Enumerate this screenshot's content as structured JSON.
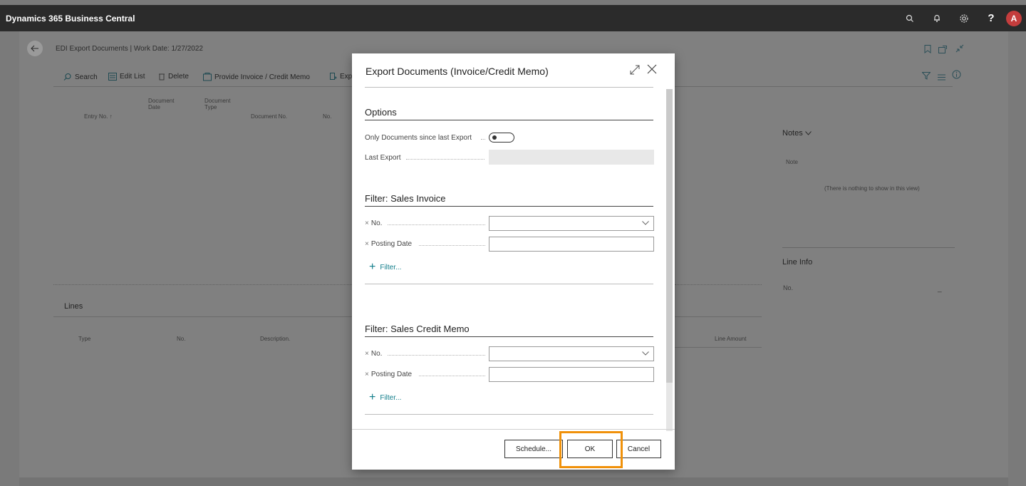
{
  "app": {
    "title": "Dynamics 365 Business Central",
    "avatar": "A",
    "help": "?"
  },
  "page": {
    "title": "EDI Export Documents | Work Date: 1/27/2022",
    "actions": [
      "Search",
      "Edit List",
      "Delete",
      "Provide Invoice / Credit Memo",
      "Exp"
    ],
    "columns": [
      {
        "label": "Entry No. ↑"
      },
      {
        "label": "Document Date"
      },
      {
        "label": "Document Type"
      },
      {
        "label": "Document No."
      },
      {
        "label": "No."
      }
    ],
    "lines": {
      "title": "Lines",
      "columns": [
        "Type",
        "No.",
        "Description.",
        "Line Amount"
      ]
    },
    "factbox": {
      "notes_title": "Notes",
      "note_label": "Note",
      "empty_message": "(There is nothing to show in this view)",
      "line_info_title": "Line Info",
      "line_no_label": "No.",
      "line_no_value": "_"
    }
  },
  "dialog": {
    "title": "Export Documents (Invoice/Credit Memo)",
    "options": {
      "title": "Options",
      "only_since_last_export_label": "Only Documents since last Export",
      "only_since_last_export_value": false,
      "last_export_label": "Last Export",
      "last_export_value": ""
    },
    "invoice_filter": {
      "title": "Filter: Sales Invoice",
      "no_label": "No.",
      "no_value": "",
      "posting_date_label": "Posting Date",
      "posting_date_value": "",
      "add_filter_label": "Filter..."
    },
    "credit_memo_filter": {
      "title": "Filter: Sales Credit Memo",
      "no_label": "No.",
      "no_value": "",
      "posting_date_label": "Posting Date",
      "posting_date_value": "",
      "add_filter_label": "Filter..."
    },
    "buttons": {
      "schedule": "Schedule...",
      "ok": "OK",
      "cancel": "Cancel"
    }
  },
  "colors": {
    "topbar": "#2b2b2b",
    "accent_link": "#117d8a",
    "highlight": "#f0910a",
    "avatar": "#c43d3d"
  }
}
